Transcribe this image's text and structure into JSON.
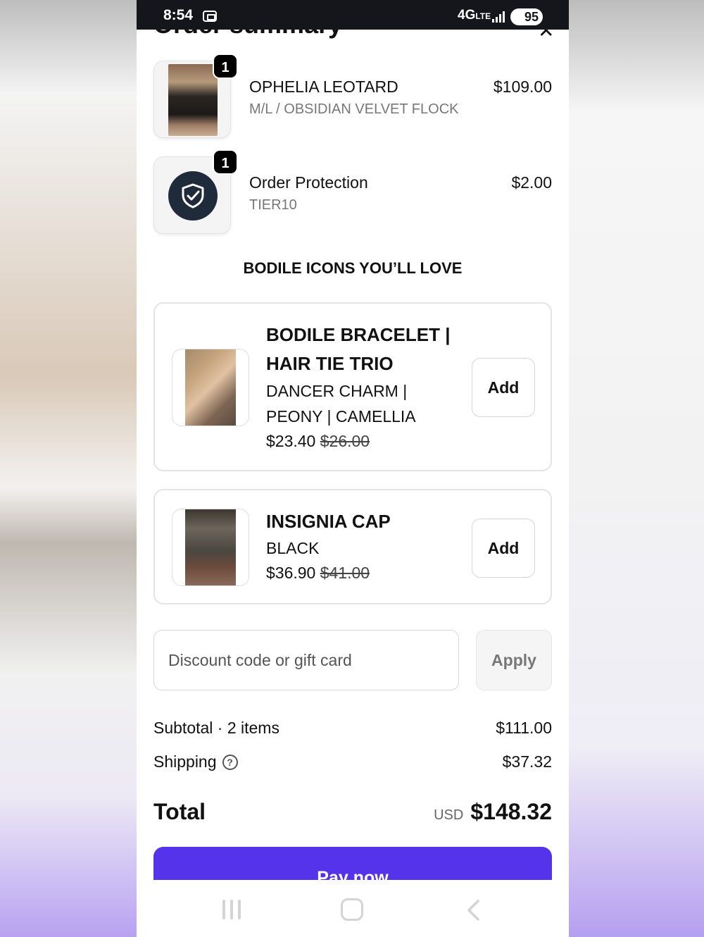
{
  "status_bar": {
    "time": "8:54",
    "network": "4G",
    "network_suffix": "LTE",
    "battery": "95"
  },
  "header": {
    "title": "Order summary"
  },
  "cart_items": [
    {
      "name": "OPHELIA LEOTARD",
      "variant": "M/L / OBSIDIAN VELVET FLOCK",
      "price": "$109.00",
      "quantity": "1"
    },
    {
      "name": "Order Protection",
      "variant": "TIER10",
      "price": "$2.00",
      "quantity": "1",
      "icon": "shield-check-icon"
    }
  ],
  "upsell": {
    "heading": "BODILE ICONS YOU’LL LOVE",
    "items": [
      {
        "title_line1": "BODILE BRACELET |",
        "title_line2": "HAIR TIE TRIO",
        "variant_line1": "DANCER CHARM |",
        "variant_line2": "PEONY | CAMELLIA",
        "price": "$23.40",
        "compare_price": "$26.00",
        "button_label": "Add"
      },
      {
        "title_line1": "INSIGNIA CAP",
        "variant_line1": "BLACK",
        "price": "$36.90",
        "compare_price": "$41.00",
        "button_label": "Add"
      }
    ]
  },
  "discount": {
    "placeholder": "Discount code or gift card",
    "button_label": "Apply"
  },
  "summary": {
    "subtotal_label": "Subtotal · 2 items",
    "subtotal_value": "$111.00",
    "shipping_label": "Shipping",
    "shipping_value": "$37.32",
    "total_label": "Total",
    "currency": "USD",
    "total_value": "$148.32"
  },
  "pay_button": {
    "label": "Pay now",
    "color": "#5433eb"
  }
}
